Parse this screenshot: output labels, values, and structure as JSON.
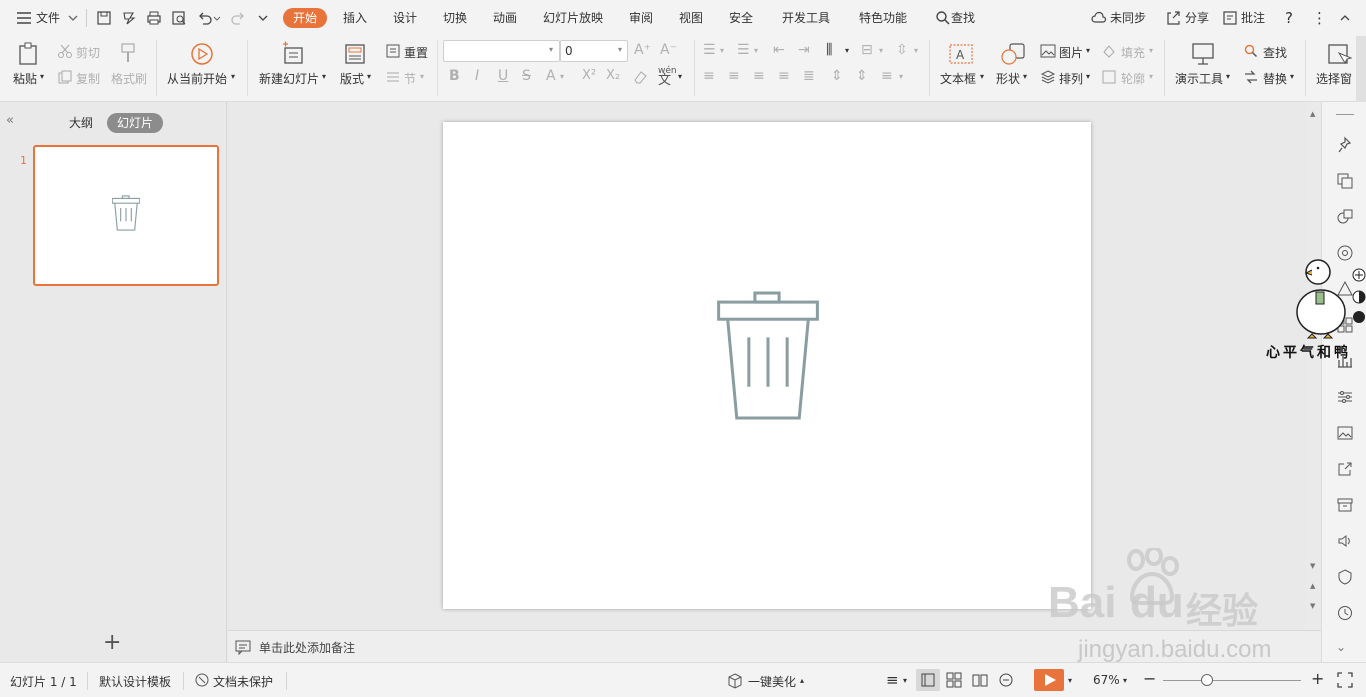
{
  "menubar": {
    "file_label": "文件",
    "tabs": [
      "开始",
      "插入",
      "设计",
      "切换",
      "动画",
      "幻灯片放映",
      "审阅",
      "视图",
      "安全",
      "开发工具",
      "特色功能"
    ],
    "search_label": "查找",
    "sync_label": "未同步",
    "share_label": "分享",
    "comment_label": "批注"
  },
  "ribbon": {
    "paste": "粘贴",
    "cut": "剪切",
    "copy": "复制",
    "format_painter": "格式刷",
    "from_current": "从当前开始",
    "new_slide": "新建幻灯片",
    "layout": "版式",
    "reset": "重置",
    "section": "节",
    "font_name": "",
    "font_size": "0",
    "text_box": "文本框",
    "shape": "形状",
    "picture": "图片",
    "fill": "填充",
    "arrange": "排列",
    "outline": "轮廓",
    "presentation_tools": "演示工具",
    "find": "查找",
    "replace": "替换",
    "select_pane": "选择窗"
  },
  "leftpanel": {
    "outline_tab": "大纲",
    "slides_tab": "幻灯片",
    "slide_number": "1"
  },
  "notes": {
    "placeholder": "单击此处添加备注"
  },
  "statusbar": {
    "slide_info": "幻灯片 1 / 1",
    "template": "默认设计模板",
    "protection": "文档未保护",
    "beautify": "一键美化",
    "zoom": "67%"
  },
  "watermark": {
    "baidu": "Bai",
    "du": "du",
    "jingyan": "经验",
    "url": "jingyan.baidu.com",
    "duck_text": "心平气和鸭"
  },
  "colors": {
    "accent": "#e8743b",
    "trash_icon": "#8a9ea2"
  },
  "icons": {
    "slide_content": "trash-can-icon"
  }
}
